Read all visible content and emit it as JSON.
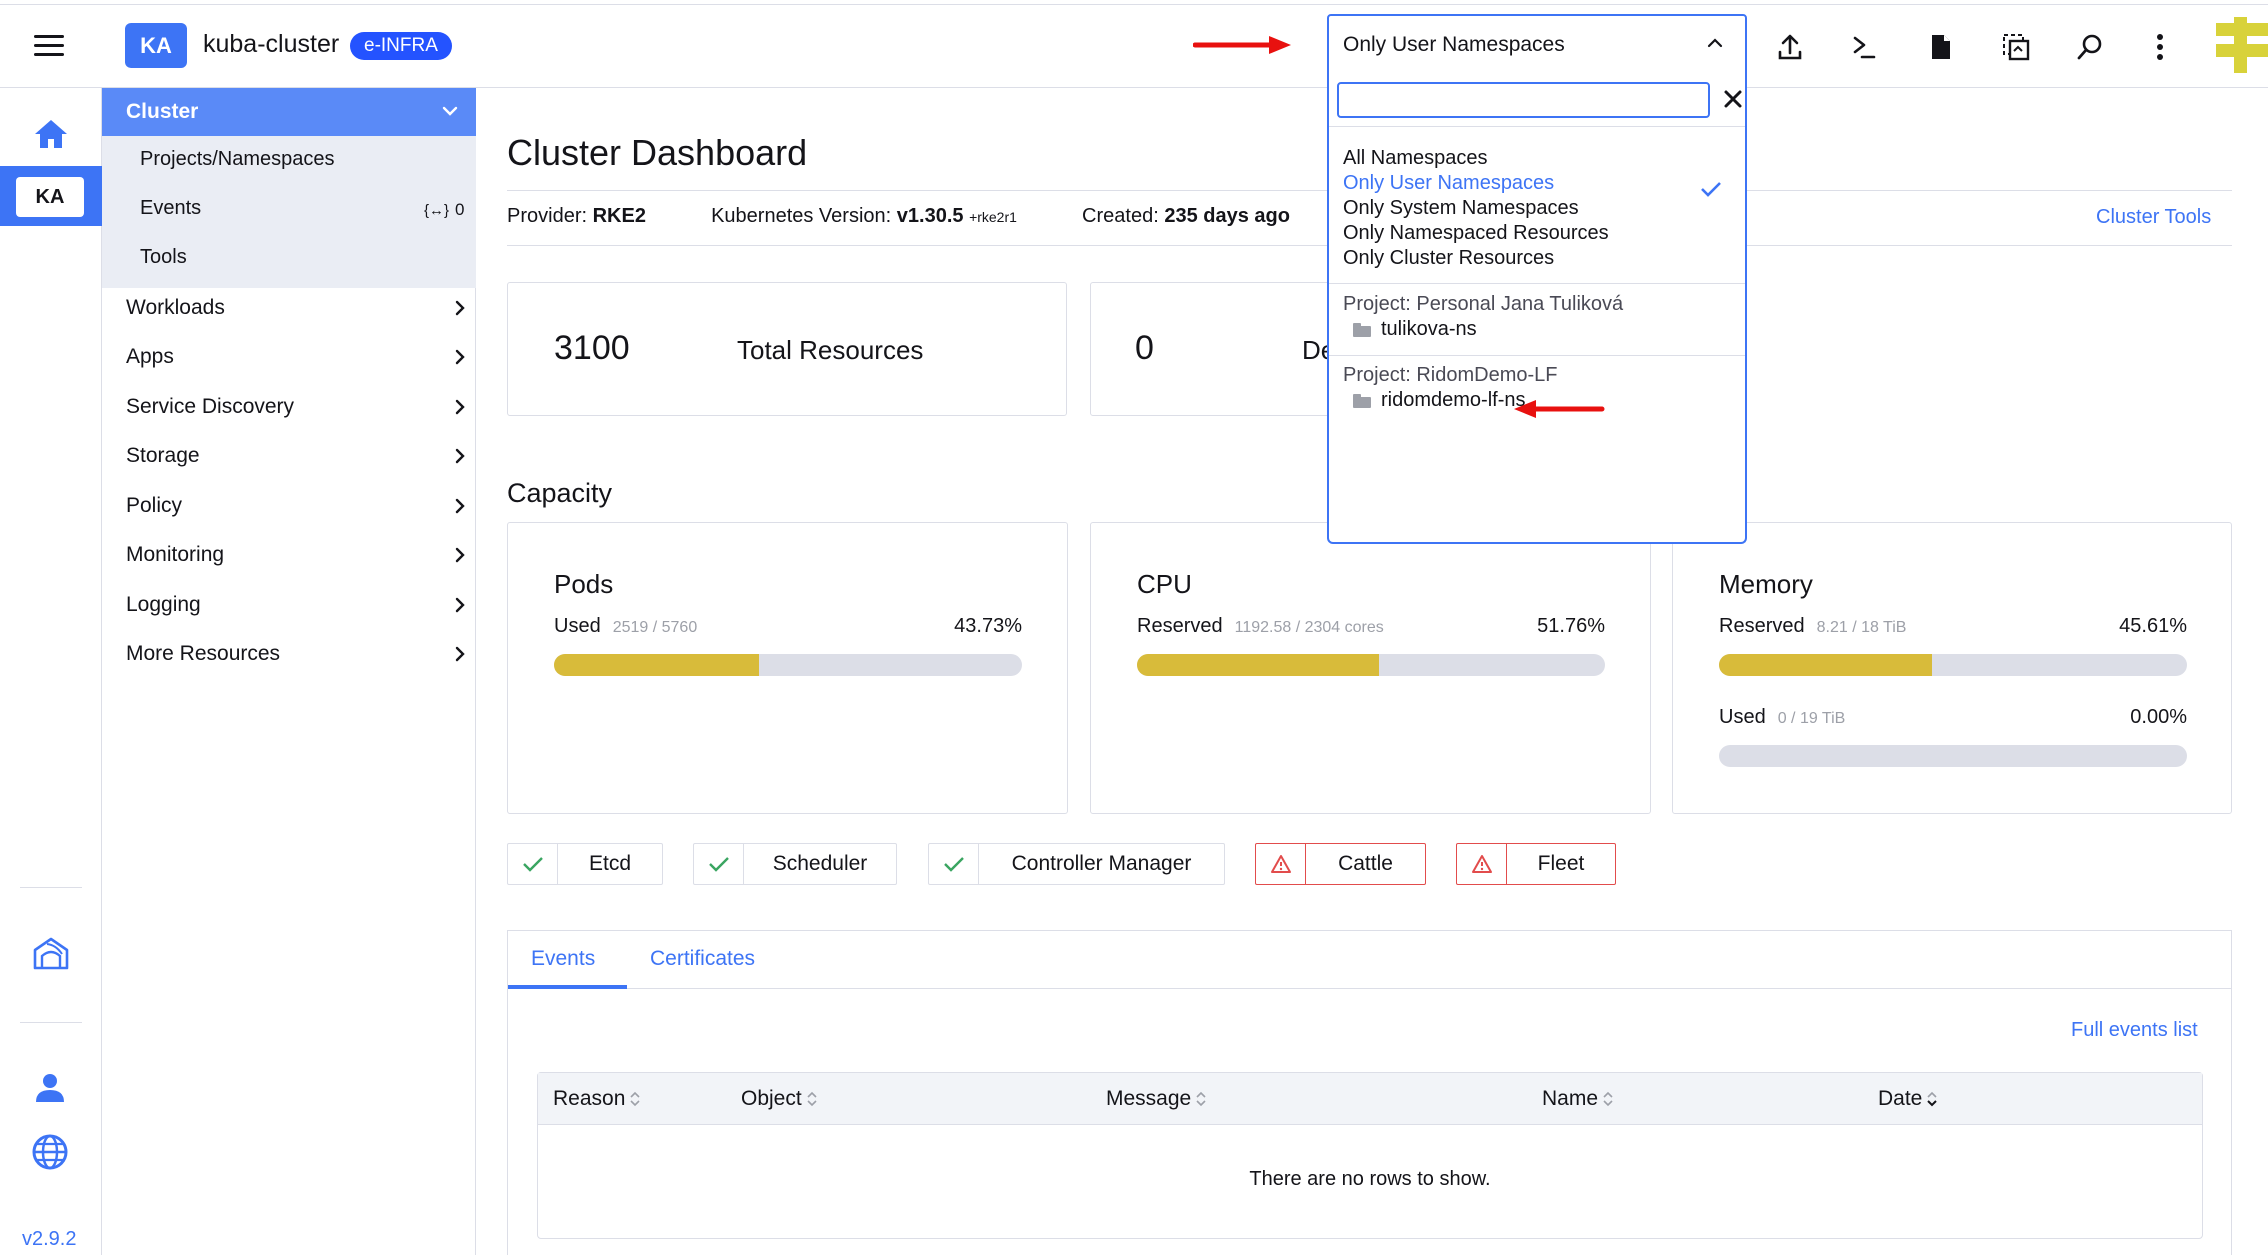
{
  "header": {
    "cluster_avatar": "KA",
    "cluster_name": "kuba-cluster",
    "cluster_badge": "e-INFRA",
    "namespace_filter": {
      "selected_label": "Only User Namespaces",
      "search_value": "",
      "options": [
        "All Namespaces",
        "Only User Namespaces",
        "Only System Namespaces",
        "Only Namespaced Resources",
        "Only Cluster Resources"
      ],
      "selected_index": 1,
      "groups": [
        {
          "label": "Project: Personal Jana Tuliková",
          "namespaces": [
            "tulikova-ns"
          ]
        },
        {
          "label": "Project: RidomDemo-LF",
          "namespaces": [
            "ridomdemo-lf-ns"
          ]
        }
      ]
    },
    "icons": [
      "import-yaml-icon",
      "kubectl-shell-icon",
      "kubeconfig-file-icon",
      "copy-kubeconfig-icon",
      "resource-search-icon",
      "more-actions-icon"
    ]
  },
  "rail": {
    "cluster_short": "KA",
    "version": "v2.9.2"
  },
  "sidenav": {
    "cluster_label": "Cluster",
    "cluster_children": [
      "Projects/Namespaces",
      "Events",
      "Tools"
    ],
    "events_count": "0",
    "items": [
      "Workloads",
      "Apps",
      "Service Discovery",
      "Storage",
      "Policy",
      "Monitoring",
      "Logging",
      "More Resources"
    ]
  },
  "main": {
    "title": "Cluster Dashboard",
    "provider_label": "Provider:",
    "provider_value": "RKE2",
    "k8s_label": "Kubernetes Version:",
    "k8s_value": "v1.30.5",
    "k8s_suffix": "+rke2r1",
    "created_label": "Created:",
    "created_value": "235 days ago",
    "cluster_tools": "Cluster Tools",
    "stats": [
      {
        "value": "3100",
        "label": "Total Resources"
      },
      {
        "value": "0",
        "label": "De"
      }
    ],
    "capacity_title": "Capacity",
    "capacity": [
      {
        "title": "Pods",
        "rows": [
          {
            "label": "Used",
            "detail": "2519 / 5760",
            "percent_text": "43.73%",
            "fraction": 0.4373
          }
        ]
      },
      {
        "title": "CPU",
        "rows": [
          {
            "label": "Reserved",
            "detail": "1192.58 / 2304 cores",
            "percent_text": "51.76%",
            "fraction": 0.5176
          }
        ]
      },
      {
        "title": "Memory",
        "rows": [
          {
            "label": "Reserved",
            "detail": "8.21 / 18 TiB",
            "percent_text": "45.61%",
            "fraction": 0.4561
          },
          {
            "label": "Used",
            "detail": "0 / 19 TiB",
            "percent_text": "0.00%",
            "fraction": 0
          }
        ]
      }
    ],
    "health": [
      {
        "label": "Etcd",
        "status": "ok"
      },
      {
        "label": "Scheduler",
        "status": "ok"
      },
      {
        "label": "Controller Manager",
        "status": "ok"
      },
      {
        "label": "Cattle",
        "status": "error"
      },
      {
        "label": "Fleet",
        "status": "error"
      }
    ],
    "tabs": [
      "Events",
      "Certificates"
    ],
    "full_events": "Full events list",
    "table": {
      "columns": [
        "Reason",
        "Object",
        "Message",
        "Name",
        "Date"
      ],
      "empty": "There are no rows to show."
    }
  },
  "colors": {
    "accent": "#3d74f5",
    "bar_fill": "#d8bb3a",
    "error": "#e24c4c",
    "ok": "#3aa561",
    "annotation_arrow": "#e8110f"
  }
}
